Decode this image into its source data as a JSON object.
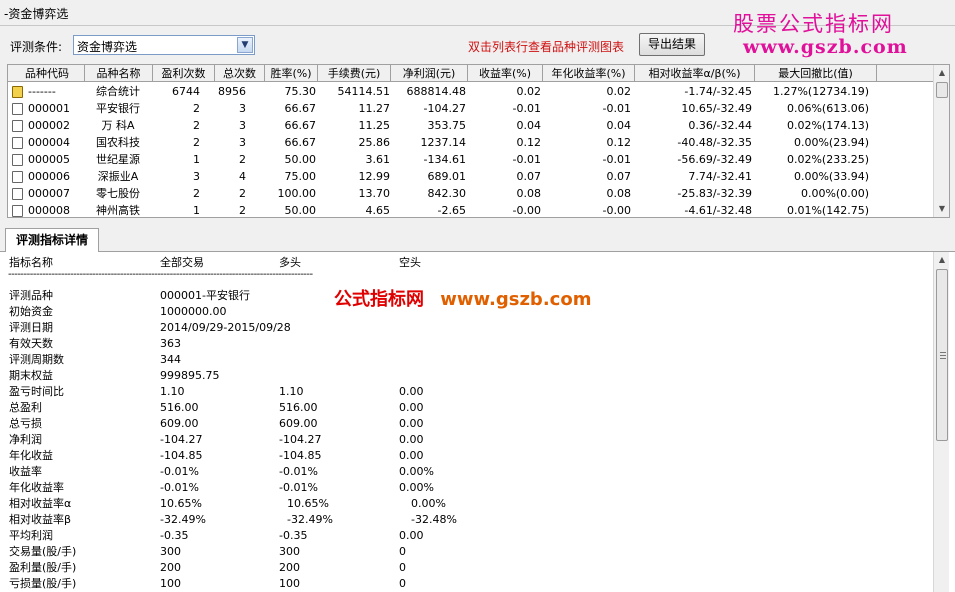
{
  "window": {
    "title": "-资金博弈选"
  },
  "watermark": {
    "line1": "股票公式指标网",
    "line2": "www.gszb.com",
    "center_cn": "公式指标网",
    "center_url": "www.gszb.com"
  },
  "toolbar": {
    "condition_label": "评测条件:",
    "condition_value": "资金博弈选",
    "hint": "双击列表行查看品种评测图表",
    "export_label": "导出结果"
  },
  "columns": [
    "品种代码",
    "品种名称",
    "盈利次数",
    "总次数",
    "胜率(%)",
    "手续费(元)",
    "净利润(元)",
    "收益率(%)",
    "年化收益率(%)",
    "相对收益率α/β(%)",
    "最大回撤比(值)"
  ],
  "rows": [
    {
      "code": "-------",
      "name": "综合统计",
      "wins": "6744",
      "total": "8956",
      "winrate": "75.30",
      "fee": "54114.51",
      "profit": "688814.48",
      "ret": "0.02",
      "annual": "0.02",
      "ab": "-1.74/-32.45",
      "dd": "1.27%(12734.19)"
    },
    {
      "code": "000001",
      "name": "平安银行",
      "wins": "2",
      "total": "3",
      "winrate": "66.67",
      "fee": "11.27",
      "profit": "-104.27",
      "ret": "-0.01",
      "annual": "-0.01",
      "ab": "10.65/-32.49",
      "dd": "0.06%(613.06)"
    },
    {
      "code": "000002",
      "name": "万 科A",
      "wins": "2",
      "total": "3",
      "winrate": "66.67",
      "fee": "11.25",
      "profit": "353.75",
      "ret": "0.04",
      "annual": "0.04",
      "ab": "0.36/-32.44",
      "dd": "0.02%(174.13)"
    },
    {
      "code": "000004",
      "name": "国农科技",
      "wins": "2",
      "total": "3",
      "winrate": "66.67",
      "fee": "25.86",
      "profit": "1237.14",
      "ret": "0.12",
      "annual": "0.12",
      "ab": "-40.48/-32.35",
      "dd": "0.00%(23.94)"
    },
    {
      "code": "000005",
      "name": "世纪星源",
      "wins": "1",
      "total": "2",
      "winrate": "50.00",
      "fee": "3.61",
      "profit": "-134.61",
      "ret": "-0.01",
      "annual": "-0.01",
      "ab": "-56.69/-32.49",
      "dd": "0.02%(233.25)"
    },
    {
      "code": "000006",
      "name": "深振业A",
      "wins": "3",
      "total": "4",
      "winrate": "75.00",
      "fee": "12.99",
      "profit": "689.01",
      "ret": "0.07",
      "annual": "0.07",
      "ab": "7.74/-32.41",
      "dd": "0.00%(33.94)"
    },
    {
      "code": "000007",
      "name": "零七股份",
      "wins": "2",
      "total": "2",
      "winrate": "100.00",
      "fee": "13.70",
      "profit": "842.30",
      "ret": "0.08",
      "annual": "0.08",
      "ab": "-25.83/-32.39",
      "dd": "0.00%(0.00)"
    },
    {
      "code": "000008",
      "name": "神州高铁",
      "wins": "1",
      "total": "2",
      "winrate": "50.00",
      "fee": "4.65",
      "profit": "-2.65",
      "ret": "-0.00",
      "annual": "-0.00",
      "ab": "-4.61/-32.48",
      "dd": "0.01%(142.75)"
    }
  ],
  "detail": {
    "tab_label": "评测指标详情",
    "headers": [
      "指标名称",
      "全部交易",
      "多头",
      "空头"
    ],
    "separator": "--------------------------------------------------------------------------------------------------",
    "items": [
      {
        "k": "评测品种",
        "a": "000001-平安银行",
        "b": "",
        "c": ""
      },
      {
        "k": "初始资金",
        "a": "1000000.00",
        "b": "",
        "c": ""
      },
      {
        "k": "评测日期",
        "a": "2014/09/29-2015/09/28",
        "b": "",
        "c": ""
      },
      {
        "k": "有效天数",
        "a": "363",
        "b": "",
        "c": ""
      },
      {
        "k": "评测周期数",
        "a": "344",
        "b": "",
        "c": ""
      },
      {
        "k": "期末权益",
        "a": "999895.75",
        "b": "",
        "c": ""
      },
      {
        "k": "盈亏时间比",
        "a": "1.10",
        "b": "1.10",
        "c": "0.00"
      },
      {
        "k": "总盈利",
        "a": "516.00",
        "b": "516.00",
        "c": "0.00"
      },
      {
        "k": "总亏损",
        "a": "609.00",
        "b": "609.00",
        "c": "0.00"
      },
      {
        "k": "净利润",
        "a": "-104.27",
        "b": "-104.27",
        "c": "0.00"
      },
      {
        "k": "年化收益",
        "a": "-104.85",
        "b": "-104.85",
        "c": "0.00"
      },
      {
        "k": "收益率",
        "a": "-0.01%",
        "b": "-0.01%",
        "c": "0.00%"
      },
      {
        "k": "年化收益率",
        "a": "-0.01%",
        "b": "-0.01%",
        "c": "0.00%"
      },
      {
        "k": "相对收益率α",
        "a": "10.65%",
        "b": "10.65%",
        "c": "0.00%"
      },
      {
        "k": "相对收益率β",
        "a": "-32.49%",
        "b": "-32.49%",
        "c": "-32.48%"
      },
      {
        "k": "平均利润",
        "a": "-0.35",
        "b": "-0.35",
        "c": "0.00"
      },
      {
        "k": "交易量(股/手)",
        "a": "300",
        "b": "300",
        "c": "0"
      },
      {
        "k": "盈利量(股/手)",
        "a": "200",
        "b": "200",
        "c": "0"
      },
      {
        "k": "亏损量(股/手)",
        "a": "100",
        "b": "100",
        "c": "0"
      }
    ]
  }
}
